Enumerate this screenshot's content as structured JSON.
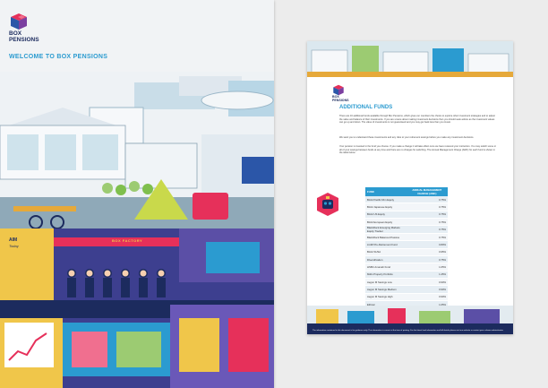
{
  "cover": {
    "brand_line1": "BOX",
    "brand_line2": "PENSIONS",
    "title": "WELCOME TO BOX PENSIONS",
    "sign_box_factory": "BOX FACTORY",
    "sign_aim": "AIM",
    "sign_today": "Today"
  },
  "inner": {
    "brand_line1": "BOX",
    "brand_line2": "PENSIONS",
    "heading": "ADDITIONAL FUNDS",
    "paragraphs": [
      "There are 16 additional funds available through Box Pensions, which gives our members the choice to explore other investment strategies and to adjust the value and balance of their investments. If you are unsure about making investment decisions then you should seek advice as the investment values can go up and down. The value of investments is not guaranteed and you may get back less than you invest.",
      "We want you to understand these investments and any risks to your retirement savings before you make any investment decisions.",
      "Your pension is invested in the fund you choose. If you make a change it will take effect once we have received your instruction. You may switch some or all of your savings between funds at any time and there are no charges for switching. The Annual Management Charge (AMC) for each fund is shown in the table below."
    ],
    "table": {
      "col_fund": "FUND",
      "col_amc": "ANNUAL MANAGEMENT CHARGE (AMC)",
      "rows": [
        {
          "fund": "BAGI Pacific Rim Equity",
          "amc": "0.75%"
        },
        {
          "fund": "BAGI Japanese Equity",
          "amc": "0.75%"
        },
        {
          "fund": "BAGI US Equity",
          "amc": "0.75%"
        },
        {
          "fund": "BAGI European Equity",
          "amc": "0.75%"
        },
        {
          "fund": "BlackRock Emerging Markets Equity Tracker",
          "amc": "0.75%"
        },
        {
          "fund": "BlackRock Balanced Passive",
          "amc": "0.75%"
        },
        {
          "fund": "LGIM Pre-Retirement Fund",
          "amc": "0.80%"
        },
        {
          "fund": "BAGI SUSA",
          "amc": "0.95%"
        },
        {
          "fund": "Diversification",
          "amc": "0.75%"
        },
        {
          "fund": "HSBC Amanah Fund",
          "amc": "1.05%"
        },
        {
          "fund": "M&G Property Portfolio",
          "amc": "1.45%"
        },
        {
          "fund": "Aegon M Savings Low",
          "amc": "0.90%"
        },
        {
          "fund": "Aegon M Savings Medium",
          "amc": "0.90%"
        },
        {
          "fund": "Aegon M Savings High",
          "amc": "0.90%"
        },
        {
          "fund": "Ethical",
          "amc": "1.05%"
        },
        {
          "fund": "M&G Recovery",
          "amc": "1.45%"
        }
      ]
    },
    "footer": "The information contained in this document is for guidance only. The information is correct at the time of printing. For the latest fund information and full details please visit our website or contact your scheme administrator."
  }
}
